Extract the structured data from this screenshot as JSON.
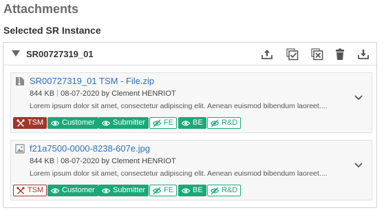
{
  "page": {
    "title": "Attachments",
    "section_title": "Selected SR Instance"
  },
  "sr": {
    "id": "SR00727319_01",
    "toolbar_icons": [
      "upload-icon",
      "select-all-icon",
      "deselect-all-icon",
      "trash-icon",
      "download-icon"
    ]
  },
  "attachments": [
    {
      "icon": "zip-file-icon",
      "file_name": "SR00727319_01 TSM - File.zip",
      "size": "844 KB",
      "uploaded": "08-07-2020 by Clement HENRIOT",
      "description": "Lorem ipsum dolor sit amet, consectetur adipiscing elit. Aenean euismod bibendum laoreet....",
      "tags": [
        {
          "label": "TSM",
          "style": "tsm-active",
          "icon": "tools-icon"
        },
        {
          "label": "Customer",
          "style": "green",
          "icon": "eye-icon"
        },
        {
          "label": "Submitter",
          "style": "green",
          "icon": "eye-icon"
        },
        {
          "label": "FE",
          "style": "green-outline",
          "icon": "eye-slash-icon"
        },
        {
          "label": "BE",
          "style": "green",
          "icon": "eye-icon"
        },
        {
          "label": "R&D",
          "style": "green-outline",
          "icon": "eye-slash-icon"
        }
      ]
    },
    {
      "icon": "image-file-icon",
      "file_name": "f21a7500-0000-8238-607e.jpg",
      "size": "844 KB",
      "uploaded": "08-07-2020 by Clement HENRIOT",
      "description": "Lorem ipsum dolor sit amet, consectetur adipiscing elit. Aenean euismod bibendum laoreet....",
      "tags": [
        {
          "label": "TSM",
          "style": "tsm-outline",
          "icon": "tools-icon"
        },
        {
          "label": "Customer",
          "style": "green",
          "icon": "eye-icon"
        },
        {
          "label": "Submitter",
          "style": "green",
          "icon": "eye-icon"
        },
        {
          "label": "FE",
          "style": "green-outline",
          "icon": "eye-slash-icon"
        },
        {
          "label": "BE",
          "style": "green",
          "icon": "eye-icon"
        },
        {
          "label": "R&D",
          "style": "green-outline",
          "icon": "eye-slash-icon"
        }
      ]
    }
  ],
  "colors": {
    "link": "#2f72b8",
    "tsm": "#a0352b",
    "visibility_green": "#1ba878"
  }
}
